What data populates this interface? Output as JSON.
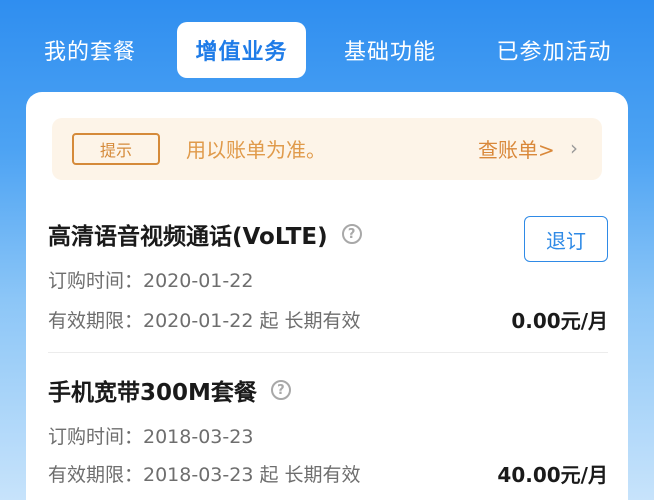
{
  "tabs": [
    {
      "label": "我的套餐",
      "active": false
    },
    {
      "label": "增值业务",
      "active": true
    },
    {
      "label": "基础功能",
      "active": false
    },
    {
      "label": "已参加活动",
      "active": false
    }
  ],
  "notice": {
    "badge": "提示",
    "text": "用以账单为准。",
    "link": "查账单>",
    "chevron": "›"
  },
  "services": [
    {
      "title": "高清语音视频通话(VoLTE)",
      "help_icon": "?",
      "order_time": "订购时间：2020-01-22",
      "validity": "有效期限：2020-01-22 起 长期有效",
      "price": "0.00元/月",
      "unsubscribe_label": "退订"
    },
    {
      "title": "手机宽带300M套餐",
      "help_icon": "?",
      "order_time": "订购时间：2018-03-23",
      "validity": "有效期限：2018-03-23 起 长期有效",
      "price": "40.00元/月"
    }
  ],
  "colors": {
    "accent": "#1f7ce8",
    "notice_bg": "#fdf4e8",
    "notice_text": "#e09a4a"
  }
}
